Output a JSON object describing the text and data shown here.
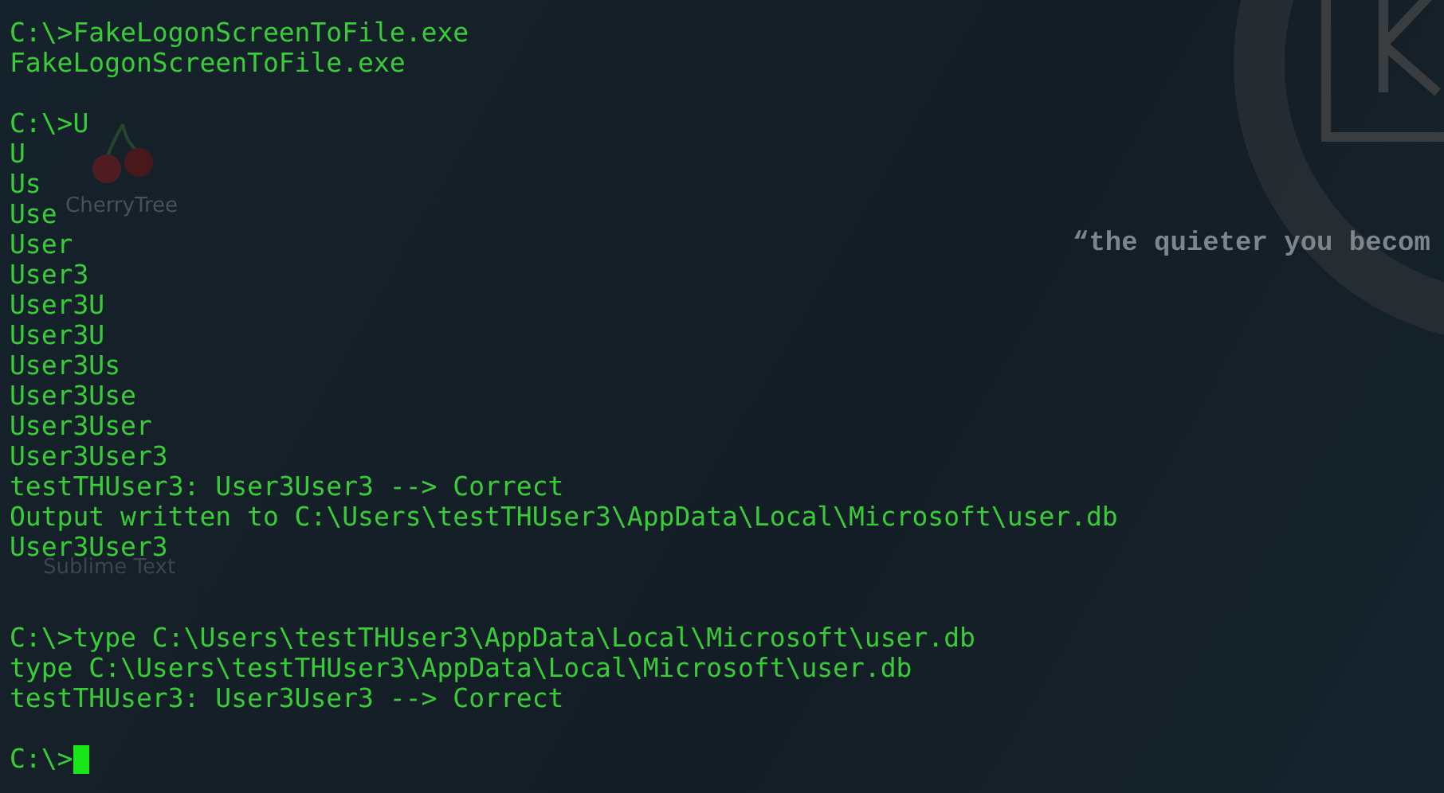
{
  "desktop": {
    "icons": [
      {
        "label": "CherryTree",
        "kind": "cherry"
      },
      {
        "label": "Sublime Text",
        "kind": "label"
      }
    ],
    "quote": "“the quieter you becom"
  },
  "terminal": {
    "lines": [
      {
        "kind": "text",
        "text": "C:\\>FakeLogonScreenToFile.exe"
      },
      {
        "kind": "text",
        "text": "FakeLogonScreenToFile.exe"
      },
      {
        "kind": "blank"
      },
      {
        "kind": "text",
        "text": "C:\\>U"
      },
      {
        "kind": "text",
        "text": "U"
      },
      {
        "kind": "text",
        "text": "Us"
      },
      {
        "kind": "text",
        "text": "Use"
      },
      {
        "kind": "text",
        "text": "User"
      },
      {
        "kind": "text",
        "text": "User3"
      },
      {
        "kind": "text",
        "text": "User3U"
      },
      {
        "kind": "text",
        "text": "User3U"
      },
      {
        "kind": "text",
        "text": "User3Us"
      },
      {
        "kind": "text",
        "text": "User3Use"
      },
      {
        "kind": "text",
        "text": "User3User"
      },
      {
        "kind": "text",
        "text": "User3User3"
      },
      {
        "kind": "text",
        "text": "testTHUser3: User3User3 --> Correct"
      },
      {
        "kind": "text",
        "text": "Output written to C:\\Users\\testTHUser3\\AppData\\Local\\Microsoft\\user.db"
      },
      {
        "kind": "text",
        "text": "User3User3"
      },
      {
        "kind": "blank"
      },
      {
        "kind": "blank"
      },
      {
        "kind": "text",
        "text": "C:\\>type C:\\Users\\testTHUser3\\AppData\\Local\\Microsoft\\user.db"
      },
      {
        "kind": "text",
        "text": "type C:\\Users\\testTHUser3\\AppData\\Local\\Microsoft\\user.db"
      },
      {
        "kind": "text",
        "text": "testTHUser3: User3User3 --> Correct"
      },
      {
        "kind": "blank"
      },
      {
        "kind": "prompt",
        "text": "C:\\>",
        "cursor": true
      }
    ]
  }
}
